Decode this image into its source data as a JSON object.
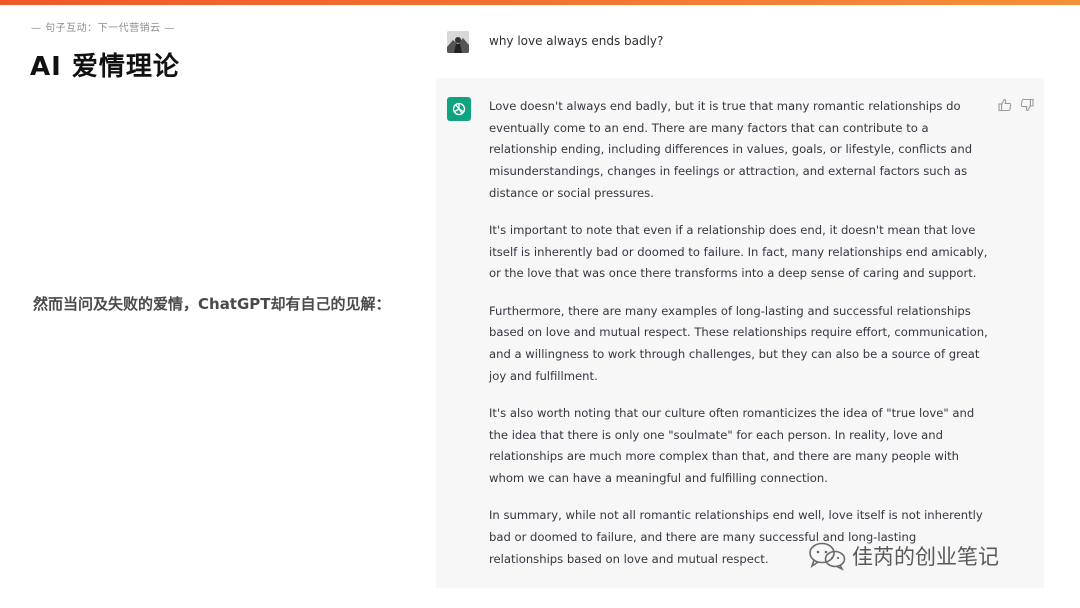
{
  "slide": {
    "kicker": "— 句子互动：下一代营销云 —",
    "title": "AI 爱情理论",
    "intro": "然而当问及失败的爱情，ChatGPT却有自己的见解："
  },
  "chat": {
    "user_message": "why love always ends badly?",
    "assistant_paragraphs": [
      "Love doesn't always end badly, but it is true that many romantic relationships do eventually come to an end. There are many factors that can contribute to a relationship ending, including differences in values, goals, or lifestyle, conflicts and misunderstandings, changes in feelings or attraction, and external factors such as distance or social pressures.",
      "It's important to note that even if a relationship does end, it doesn't mean that love itself is inherently bad or doomed to failure. In fact, many relationships end amicably, or the love that was once there transforms into a deep sense of caring and support.",
      "Furthermore, there are many examples of long-lasting and successful relationships based on love and mutual respect. These relationships require effort, communication, and a willingness to work through challenges, but they can also be a source of great joy and fulfillment.",
      "It's also worth noting that our culture often romanticizes the idea of \"true love\" and the idea that there is only one \"soulmate\" for each person. In reality, love and relationships are much more complex than that, and there are many people with whom we can have a meaningful and fulfilling connection.",
      "In summary, while not all romantic relationships end well, love itself is not inherently bad or doomed to failure, and there are many successful and long-lasting relationships based on love and mutual respect."
    ],
    "icons": {
      "user": "user-avatar",
      "assistant": "openai-logo-icon",
      "like": "thumbs-up-icon",
      "dislike": "thumbs-down-icon"
    }
  },
  "watermark": {
    "text": "佳芮的创业笔记",
    "icon": "wechat-icon"
  },
  "colors": {
    "accent_start": "#f0582a",
    "accent_end": "#f6903a",
    "assistant_bg": "#f7f7f8",
    "gpt_green": "#10a37f"
  }
}
